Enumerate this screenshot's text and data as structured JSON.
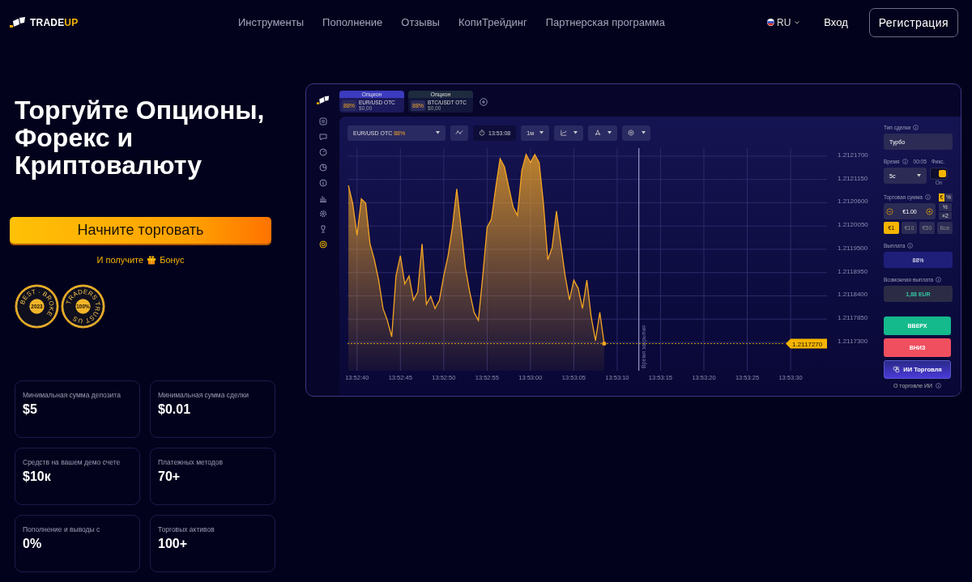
{
  "header": {
    "logo": {
      "text": "TRADE",
      "accent": "UP"
    },
    "nav": [
      "Инструменты",
      "Пополнение",
      "Отзывы",
      "КопиТрейдинг",
      "Партнерская программа"
    ],
    "language": "RU",
    "login": "Вход",
    "register": "Регистрация"
  },
  "hero": {
    "title": "Торгуйте Опционы, Форекс и Криптовалюту",
    "cta": "Начните торговать",
    "bonus_before": "И получите",
    "bonus_after": "Бонус",
    "badges": [
      {
        "ring": "BEST · BROKE",
        "center": "2023"
      },
      {
        "ring": "TRADERS TRUST US",
        "center": "100%"
      }
    ]
  },
  "stats": [
    {
      "label": "Минимальная сумма депозита",
      "value": "$5"
    },
    {
      "label": "Минимальная сумма сделки",
      "value": "$0.01"
    },
    {
      "label": "Средств на вашем демо счете",
      "value": "$10к"
    },
    {
      "label": "Платежных методов",
      "value": "70+"
    },
    {
      "label": "Пополнение и выводы с",
      "value": "0%"
    },
    {
      "label": "Торговых активов",
      "value": "100+"
    }
  ],
  "platform": {
    "tabs": [
      {
        "header": "Опцион",
        "percent": "88%",
        "pair": "EUR/USD OTC",
        "amount": "$0,00",
        "selected": true
      },
      {
        "header": "Опцион",
        "percent": "88%",
        "pair": "BTC/USDT OTC",
        "amount": "$0,00",
        "selected": false
      }
    ],
    "toolbar": {
      "asset_percent": "88%",
      "clock": "13:53:08",
      "timeframe": "1м"
    },
    "chart_data": {
      "type": "area",
      "categories": [
        null,
        null,
        "13:52:40",
        null,
        null,
        null,
        null,
        null,
        null,
        null,
        null,
        null,
        "13:52:45",
        null,
        null,
        null,
        null,
        null,
        null,
        null,
        null,
        null,
        "13:52:50",
        null,
        null,
        null,
        null,
        null,
        null,
        null,
        null,
        null,
        "13:52:55",
        null,
        null,
        null,
        null,
        null,
        null,
        null,
        null,
        null,
        "13:53:00",
        null,
        null,
        null,
        null,
        null,
        null,
        null,
        null,
        null,
        "13:53:05",
        null,
        null,
        null,
        null,
        null,
        null,
        null,
        null,
        null,
        "13:53:10",
        null,
        null,
        null,
        null,
        null,
        null,
        null,
        null,
        null,
        "13:53:15",
        null,
        null,
        null,
        null,
        null,
        null,
        null,
        null,
        null,
        "13:53:20",
        null,
        null,
        null,
        null,
        null,
        null,
        null,
        null,
        null,
        "13:53:25",
        null,
        null,
        null,
        null,
        null,
        null,
        null,
        null,
        null,
        "13:53:30"
      ],
      "series": [
        {
          "name": "EUR/USD OTC",
          "color": "#f5a623",
          "values": [
            1.212101,
            1.212059,
            1.211983,
            1.212069,
            1.212059,
            1.211963,
            1.211925,
            1.211877,
            1.21181,
            1.211782,
            1.211743,
            1.211887,
            1.211935,
            1.211868,
            1.211887,
            1.21183,
            1.211849,
            1.211963,
            1.21182,
            1.211839,
            1.21181,
            1.21183,
            1.211887,
            1.211935,
            1.212002,
            1.212093,
            1.212002,
            1.211906,
            1.211849,
            1.211801,
            1.211782,
            1.211887,
            1.212002,
            1.212021,
            1.212097,
            1.212164,
            1.212145,
            1.212097,
            1.21205,
            1.21203,
            1.212136,
            1.212174,
            1.212155,
            1.212174,
            1.212155,
            1.212059,
            1.211925,
            1.211954,
            1.21204,
            1.211963,
            1.211887,
            1.21183,
            1.211877,
            1.211858,
            1.21181,
            1.211877,
            1.211791,
            1.211734,
            1.211801,
            1.211727,
            null,
            null,
            null,
            null,
            null,
            null,
            null,
            null,
            null,
            null,
            null,
            null,
            null,
            null,
            null,
            null,
            null,
            null,
            null,
            null,
            null,
            null,
            null,
            null,
            null,
            null,
            null,
            null,
            null,
            null,
            null,
            null,
            null,
            null,
            null,
            null,
            null,
            null,
            null,
            null,
            null,
            null,
            null
          ]
        }
      ],
      "ylim": [
        1.211663,
        1.212189
      ],
      "grid": true,
      "ref_lines": [
        {
          "axis": "y",
          "value": 1.211727,
          "label": "1.2117270"
        }
      ],
      "yticks": [
        {
          "value": 1.21217,
          "label": "1.2121700"
        },
        {
          "value": 1.212115,
          "label": "1.2121150"
        },
        {
          "value": 1.21206,
          "label": "1.2120600"
        },
        {
          "value": 1.212005,
          "label": "1.2120050"
        },
        {
          "value": 1.21195,
          "label": "1.2119500"
        },
        {
          "value": 1.211895,
          "label": "1.2118950"
        },
        {
          "value": 1.21184,
          "label": "1.2118400"
        },
        {
          "value": 1.211785,
          "label": "1.2117850"
        },
        {
          "value": 1.21173,
          "label": "1.2117300"
        }
      ],
      "annotations": [
        "Время закрытия"
      ]
    },
    "panel": {
      "trade_type": {
        "label": "Тип сделки",
        "value": "Турбо"
      },
      "time": {
        "label": "Время",
        "countdown": "00:05",
        "value": "5с"
      },
      "fixed": {
        "label": "Фикс.",
        "on": true,
        "state_text": "On"
      },
      "amount": {
        "label": "Торговая сумма",
        "modes": [
          {
            "label": "€",
            "selected": true
          },
          {
            "label": "%",
            "selected": false
          }
        ],
        "value": "€1.00",
        "half": "½",
        "double": "×2",
        "presets": [
          {
            "label": "€1",
            "selected": true
          },
          {
            "label": "€10",
            "selected": false
          },
          {
            "label": "€50",
            "selected": false
          },
          {
            "label": "Все",
            "selected": false
          }
        ]
      },
      "payout": {
        "label": "Выплата",
        "value": "88%"
      },
      "possible": {
        "label": "Возможная выплата",
        "value": "1,88 EUR"
      },
      "up": "ВВЕРХ",
      "down": "ВНИЗ",
      "ai": "ИИ Торговля",
      "ai_note": "О торговле ИИ"
    }
  }
}
